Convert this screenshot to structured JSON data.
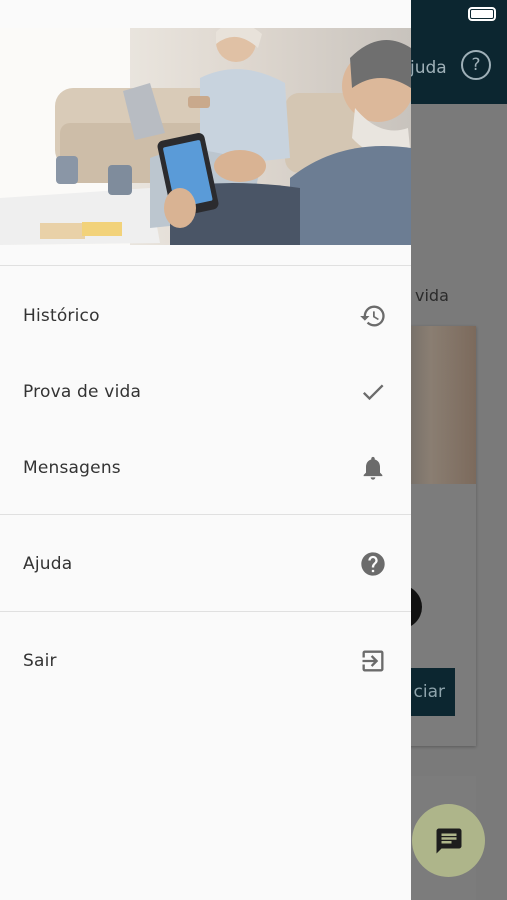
{
  "status_bar": {
    "left_text": ""
  },
  "background": {
    "header_help_label": "juda",
    "help_icon": "question-circle-icon",
    "partial_text": "vida",
    "button_partial_label": "ciar",
    "fab_icon": "chat-icon"
  },
  "drawer": {
    "hero_image": "elderly-couple-using-smartphone-photo",
    "menu": [
      {
        "label": "Histórico",
        "icon": "history-icon"
      },
      {
        "label": "Prova de vida",
        "icon": "check-icon"
      },
      {
        "label": "Mensagens",
        "icon": "bell-icon"
      },
      {
        "label": "Ajuda",
        "icon": "help-circle-icon"
      },
      {
        "label": "Sair",
        "icon": "exit-icon"
      }
    ]
  },
  "colors": {
    "drawer_bg": "#fafafa",
    "header_bg": "#0c2630",
    "icon_gray": "#6b6b6b",
    "fab_bg": "#aeb58a"
  }
}
